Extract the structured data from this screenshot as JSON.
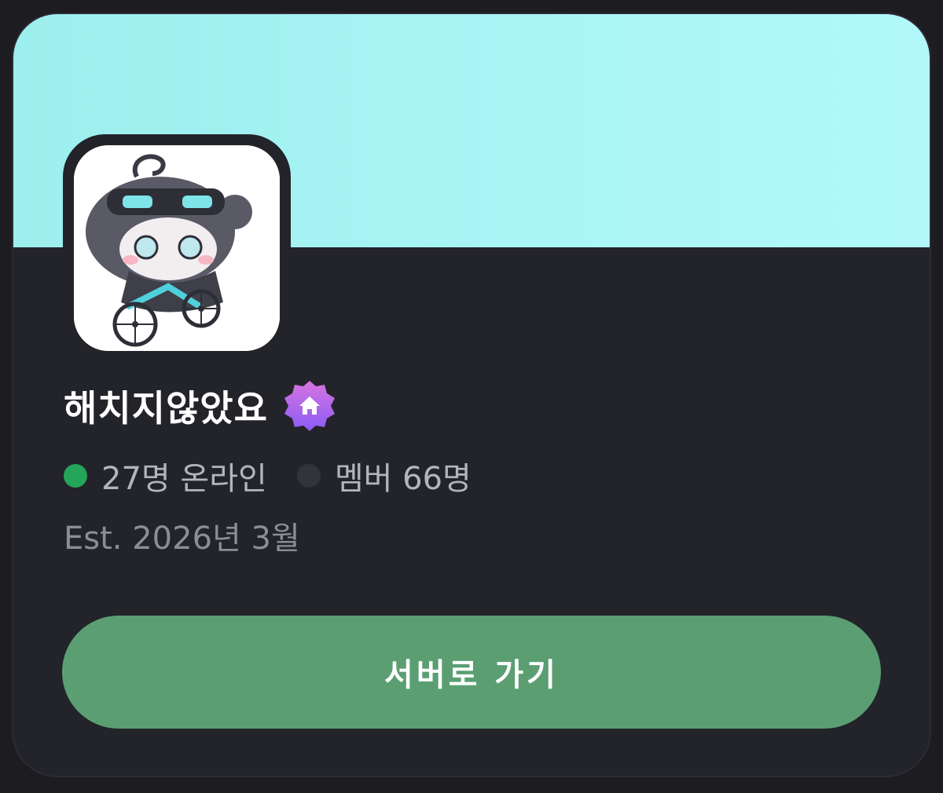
{
  "server": {
    "name": "해치지않았요",
    "badge_icon": "home-icon",
    "online_text": "27명 온라인",
    "members_text": "멤버 66명",
    "established": "Est. 2026년 3월",
    "avatar_icon": "server-avatar-character"
  },
  "actions": {
    "go_to_server_label": "서버로 가기"
  },
  "colors": {
    "background": "#1c1c21",
    "card": "#23232a",
    "banner": "#a9f5f6",
    "online_dot": "#23a55a",
    "member_dot": "#33343b",
    "button": "#5b9e72",
    "badge_gradient_top": "#d874e0",
    "badge_gradient_bottom": "#8b5cf6"
  }
}
